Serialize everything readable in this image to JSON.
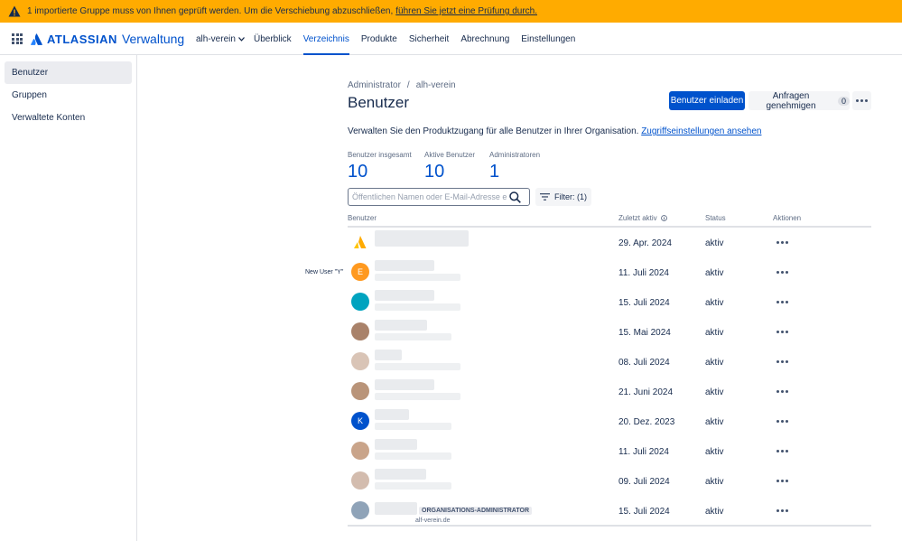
{
  "banner": {
    "text": "1 importierte Gruppe muss von Ihnen geprüft werden. Um die Verschiebung abzuschließen,",
    "link": "führen Sie jetzt eine Prüfung durch.",
    "color": "#ffab00"
  },
  "topnav": {
    "brand": "ATLASSIAN",
    "product": "Verwaltung",
    "org": "alh-verein",
    "items": [
      "Überblick",
      "Verzeichnis",
      "Produkte",
      "Sicherheit",
      "Abrechnung",
      "Einstellungen"
    ],
    "active": "Verzeichnis"
  },
  "sidebar": {
    "items": [
      "Benutzer",
      "Gruppen",
      "Verwaltete Konten"
    ],
    "active": "Benutzer"
  },
  "breadcrumb": [
    "Administrator",
    "alh-verein"
  ],
  "page": {
    "title": "Benutzer",
    "invite_button": "Benutzer einladen",
    "requests_button": "Anfragen genehmigen",
    "requests_count": "0",
    "intro": "Verwalten Sie den Produktzugang für alle Benutzer in Ihrer Organisation.",
    "intro_link": "Zugriffseinstellungen ansehen"
  },
  "stats": [
    {
      "label": "Benutzer insgesamt",
      "value": "10"
    },
    {
      "label": "Aktive Benutzer",
      "value": "10"
    },
    {
      "label": "Administratoren",
      "value": "1"
    }
  ],
  "search": {
    "placeholder": "Öffentlichen Namen oder E-Mail-Adresse ei..."
  },
  "filter": {
    "label": "Filter: (1)"
  },
  "table": {
    "headers": {
      "user": "Benutzer",
      "last_active": "Zuletzt aktiv",
      "status": "Status",
      "actions": "Aktionen"
    },
    "rows": [
      {
        "date": "29. Apr. 2024",
        "status": "aktiv",
        "avatar": "logo"
      },
      {
        "date": "11. Juli 2024",
        "status": "aktiv",
        "avatar": "E",
        "avatar_color": "#ff991f"
      },
      {
        "date": "15. Juli 2024",
        "status": "aktiv",
        "avatar": "teal",
        "avatar_color": "#00a3bf"
      },
      {
        "date": "15. Mai 2024",
        "status": "aktiv",
        "avatar": "photo"
      },
      {
        "date": "08. Juli 2024",
        "status": "aktiv",
        "avatar": "photo"
      },
      {
        "date": "21. Juni 2024",
        "status": "aktiv",
        "avatar": "photo"
      },
      {
        "date": "20. Dez. 2023",
        "status": "aktiv",
        "avatar": "K",
        "avatar_color": "#0052cc"
      },
      {
        "date": "11. Juli 2024",
        "status": "aktiv",
        "avatar": "photo"
      },
      {
        "date": "09. Juli 2024",
        "status": "aktiv",
        "avatar": "photo"
      },
      {
        "date": "15. Juli 2024",
        "status": "aktiv",
        "avatar": "photo",
        "tag": "ORGANISATIONS-ADMINISTRATOR",
        "email_suffix": "alf-verein.de"
      }
    ],
    "new_user_label": "New User \"Y\""
  }
}
